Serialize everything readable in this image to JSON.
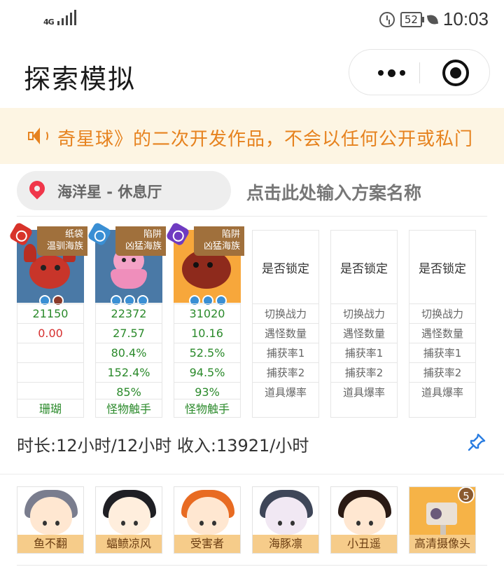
{
  "status_bar": {
    "network": "4G",
    "battery": "52",
    "time": "10:03"
  },
  "header": {
    "title": "探索模拟"
  },
  "notice": {
    "text": "奇星球》的二次开发作品，不会以任何公开或私门"
  },
  "location": {
    "name": "海洋星 - 休息厅",
    "plan_placeholder": "点击此处输入方案名称"
  },
  "team": [
    {
      "element": "fire",
      "tag_line1": "纸袋",
      "tag_line2": "温驯海族",
      "gems": [
        "water",
        "red"
      ],
      "power": "21150",
      "encounter": "0.00",
      "capture1": "",
      "capture2": "",
      "drop": "",
      "skill": "珊瑚"
    },
    {
      "element": "water",
      "tag_line1": "陷阱",
      "tag_line2": "凶猛海族",
      "gems": [
        "water",
        "water",
        "water"
      ],
      "power": "22372",
      "encounter": "27.57",
      "capture1": "80.4%",
      "capture2": "152.4%",
      "drop": "85%",
      "skill": "怪物触手"
    },
    {
      "element": "dark",
      "tag_line1": "陷阱",
      "tag_line2": "凶猛海族",
      "gems": [
        "water",
        "water",
        "water"
      ],
      "power": "31020",
      "encounter": "10.16",
      "capture1": "52.5%",
      "capture2": "94.5%",
      "drop": "93%",
      "skill": "怪物触手"
    }
  ],
  "empty_slot": {
    "lock": "是否锁定",
    "power": "切换战力",
    "encounter": "遇怪数量",
    "capture1": "捕获率1",
    "capture2": "捕获率2",
    "drop": "道具爆率"
  },
  "summary": {
    "text": "时长:12小时/12小时 收入:13921/小时"
  },
  "helpers": [
    {
      "name": "鱼不翻"
    },
    {
      "name": "蝠鲼凉风"
    },
    {
      "name": "受害者"
    },
    {
      "name": "海豚凛"
    },
    {
      "name": "小丑遥"
    },
    {
      "name": "高清摄像头",
      "badge": "5"
    }
  ]
}
